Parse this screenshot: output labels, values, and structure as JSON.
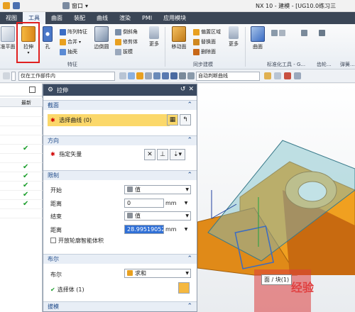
{
  "titlebar": {
    "window_menu": "窗口",
    "title": "NX 10 - 建模 - [UG10.0练习三"
  },
  "menu": {
    "tabs": [
      "视图",
      "工具",
      "曲面",
      "装配",
      "曲线",
      "渲染",
      "PMI",
      "应用模块"
    ]
  },
  "ribbon": {
    "datum_plane": "准平面",
    "extrude": "拉伸",
    "hole": "孔",
    "pattern_feature": "阵列特征",
    "unite": "合并",
    "shell": "抽壳",
    "edge_blend": "边倒圆",
    "chamfer": "倒斜角",
    "trim_body": "修剪体",
    "draft": "拔模",
    "more1": "更多",
    "offset_region": "偏置区域",
    "replace_face": "替换面",
    "delete_face": "删除面",
    "move_face": "移动面",
    "more2": "更多",
    "surface": "曲面",
    "group_feature": "特征",
    "group_sync": "同步建模",
    "group_std": "标准化工具 - G...",
    "group_gear": "齿轮...",
    "group_spring": "弹簧..."
  },
  "selbar": {
    "filter": "仅在工作部件内",
    "curve_rule": "自动判断曲线"
  },
  "navigator": {
    "col_latest": "最新",
    "checks": [
      "✔",
      "✔",
      "✔",
      "✔",
      "✔",
      "✔"
    ]
  },
  "dialog": {
    "title": "拉伸",
    "sec_section": "截面",
    "select_curve": "选择曲线 (0)",
    "sec_direction": "方向",
    "specify_vector": "指定矢量",
    "sec_limits": "限制",
    "start_label": "开始",
    "start_value": "值",
    "start_dist_label": "距离",
    "start_dist_value": "0",
    "end_label": "结束",
    "end_value": "值",
    "end_dist_label": "距离",
    "end_dist_value": "28.99519052",
    "unit": "mm",
    "open_profile": "开放轮廓智能体积",
    "sec_boolean": "布尔",
    "boolean_label": "布尔",
    "boolean_value": "求和",
    "select_body": "选择体 (1)",
    "sec_draft": "拔模"
  },
  "viewport": {
    "tooltip": "面 / 块(1)",
    "watermark": "经验"
  }
}
